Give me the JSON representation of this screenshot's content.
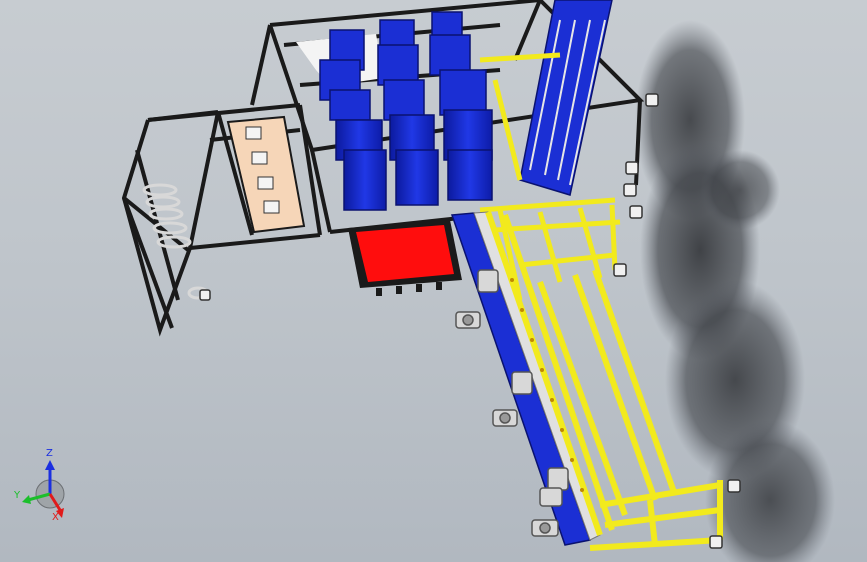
{
  "viewport": {
    "background_top": "#c7ccd1",
    "background_bottom": "#b1b8c0"
  },
  "model": {
    "colors": {
      "frame": "#1a1a1a",
      "conveyor_frame": "#f2ea1d",
      "module_blue": "#1b2fd4",
      "tray": "#ff0d0d",
      "panel": "#f6d6b8",
      "metal": "#d8d8d8"
    }
  },
  "triad": {
    "x_label": "X",
    "y_label": "Y",
    "z_label": "Z",
    "x_color": "#e01b1b",
    "y_color": "#1bbf2b",
    "z_color": "#1b2fe0"
  }
}
